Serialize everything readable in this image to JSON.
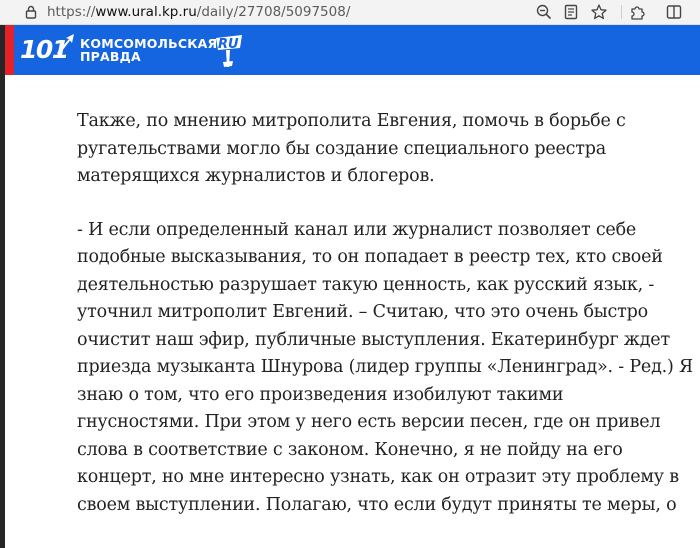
{
  "browser": {
    "url_prefix": "https://",
    "url_host": "www.ural.kp.ru",
    "url_path": "/daily/27708/5097508/"
  },
  "site": {
    "logo_number": "101",
    "logo_name_line1": "комсомольская",
    "logo_name_line2": "правда",
    "logo_ru": "RU"
  },
  "article": {
    "paragraph1": [
      "Также, по мнению митрополита Евгения, помочь в борьбе с",
      "ругательствами могло бы создание специального реестра",
      "матерящихся журналистов и блогеров."
    ],
    "paragraph2": [
      "- И если определенный канал или журналист позволяет себе",
      "подобные высказывания, то он попадает в реестр тех, кто своей",
      "деятельностью разрушает такую ценность, как русский язык, -",
      "уточнил митрополит Евгений. – Считаю, что это очень быстро",
      "очистит наш эфир, публичные выступления. Екатеринбург ждет",
      "приезда музыканта Шнурова (лидер группы «Ленинград». - Ред.) Я",
      "знаю о том, что его произведения изобилуют такими",
      "гнусностями. При этом у него есть версии песен, где он привел",
      "слова в соответствие с законом. Конечно, я не пойду на его",
      "концерт, но мне интересно узнать, как он отразит эту проблему в",
      "своем выступлении. Полагаю, что если будут приняты те меры, о"
    ]
  },
  "colors": {
    "header_blue": "#1565e0",
    "header_red": "#e32229",
    "text": "#222222"
  }
}
